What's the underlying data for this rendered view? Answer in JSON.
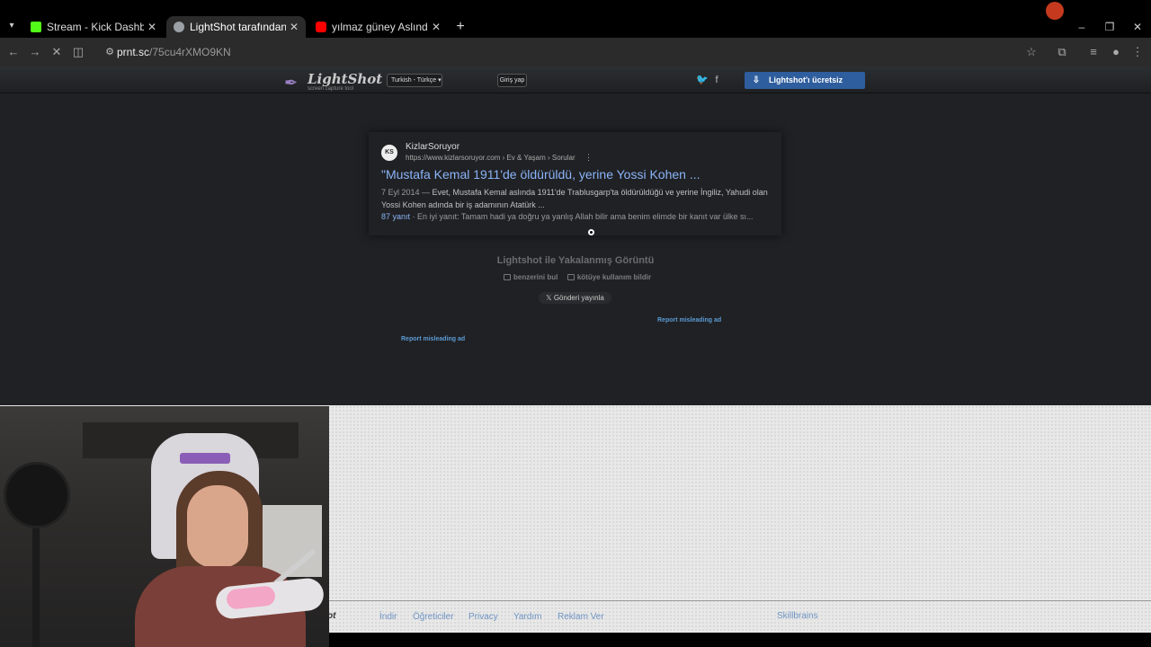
{
  "browser": {
    "tabs": [
      {
        "title": "Stream - Kick Dashboard",
        "favicon_color": "#53fc18",
        "active": false
      },
      {
        "title": "LightShot tarafından Ekran Gör",
        "favicon_color": "#9aa0a6",
        "active": true
      },
      {
        "title": "yılmaz güney Aslında Kimdi? | Y",
        "favicon_color": "#ff0000",
        "active": false
      }
    ],
    "url_host": "prnt.sc",
    "url_path": "/75cu4rXMO9KN",
    "window_controls": [
      "–",
      "❐",
      "✕"
    ]
  },
  "lightshot": {
    "logo_name": "LightShot",
    "logo_tagline": "screen capture tool",
    "language_select": "Turkish - Türkçe",
    "login_label": "Giriş yap",
    "download_label": "Lightshot'ı ücretsiz indirin",
    "caption": "Lightshot ile Yakalanmış Görüntü",
    "find_similar": "benzerini bul",
    "report_abuse": "kötüye kullanım bildir",
    "post_label": "Gönderi yayınla",
    "report_ad_1": "Report misleading ad",
    "report_ad_2": "Report misleading ad"
  },
  "screenshot": {
    "badge": "KS",
    "site_name": "KizlarSoruyor",
    "breadcrumb": "https://www.kizlarsoruyor.com › Ev & Yaşam › Sorular",
    "title": "\"Mustafa Kemal 1911'de öldürüldü, yerine Yossi Kohen ...",
    "date": "7 Eyl 2014 —",
    "snippet": "Evet, Mustafa Kemal aslında 1911'de Trablusgarp'ta öldürüldüğü ve yerine İngiliz, Yahudi olan Yossi Kohen adında bir iş adamının Atatürk ...",
    "answers": "87 yanıt",
    "best_answer": "· En iyi yanıt: Tamam hadi ya doğru ya yanlış Allah bilir ama benim elimde bir kanıt var ülke sı..."
  },
  "footer": {
    "brand_fragment": "ot",
    "links": [
      "İndir",
      "Öğreticiler",
      "Privacy",
      "Yardım",
      "Reklam Ver"
    ],
    "partner": "Skillbrains"
  }
}
